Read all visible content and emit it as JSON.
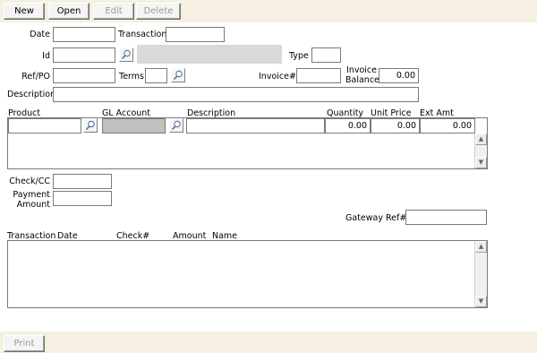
{
  "toolbar": {
    "new_label": "New",
    "open_label": "Open",
    "edit_label": "Edit",
    "delete_label": "Delete"
  },
  "form": {
    "date_label": "Date",
    "transaction_label": "Transaction",
    "id_label": "Id",
    "type_label": "Type",
    "ref_po_label": "Ref/PO",
    "terms_label": "Terms",
    "invoice_label": "Invoice#",
    "invoice_balance_label_1": "Invoice",
    "invoice_balance_label_2": "Balance",
    "invoice_balance_value": "0.00",
    "description_label": "Description"
  },
  "grid": {
    "headers": {
      "product": "Product",
      "gl_account": "GL Account",
      "description": "Description",
      "quantity": "Quantity",
      "unit_price": "Unit Price",
      "ext_amt": "Ext Amt"
    },
    "row": {
      "quantity": "0.00",
      "unit_price": "0.00",
      "ext_amt": "0.00"
    }
  },
  "payment": {
    "check_cc_label": "Check/CC",
    "payment_amount_label_1": "Payment",
    "payment_amount_label_2": "Amount",
    "gateway_ref_label": "Gateway Ref#"
  },
  "transactions": {
    "headers": {
      "transaction": "Transaction",
      "date": "Date",
      "check": "Check#",
      "amount": "Amount",
      "name": "Name"
    }
  },
  "footer": {
    "print_label": "Print"
  },
  "icons": {
    "lookup": "magnifier-icon",
    "scroll_up": "up-arrow-icon",
    "scroll_down": "down-arrow-icon"
  }
}
